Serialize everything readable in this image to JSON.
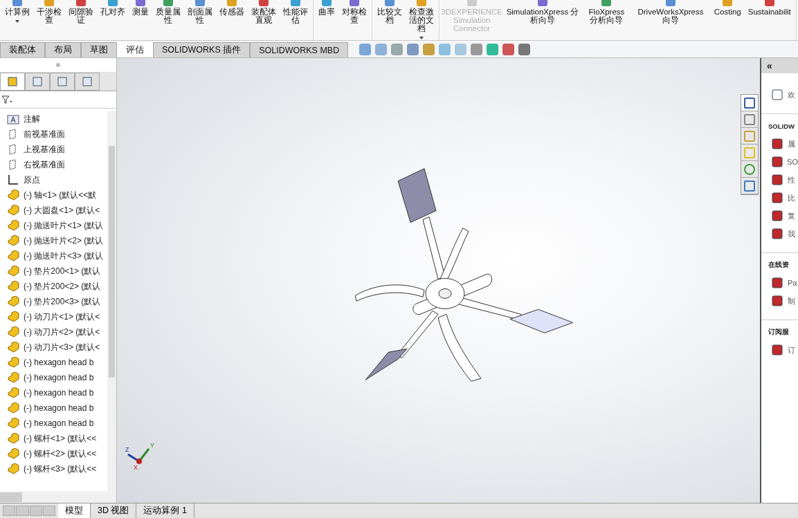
{
  "ribbon": {
    "groups": [
      {
        "buttons": [
          {
            "label": "计算例",
            "dropdown": true,
            "disabled": false
          },
          {
            "label": "干涉检查",
            "dropdown": false,
            "disabled": false
          },
          {
            "label": "间隙验证",
            "dropdown": false,
            "disabled": false
          },
          {
            "label": "孔对齐",
            "dropdown": false,
            "disabled": false
          },
          {
            "label": "测量",
            "dropdown": false,
            "disabled": false
          },
          {
            "label": "质量属性",
            "dropdown": false,
            "disabled": false
          },
          {
            "label": "剖面属性",
            "dropdown": false,
            "disabled": false
          },
          {
            "label": "传感器",
            "dropdown": false,
            "disabled": false
          },
          {
            "label": "装配体直观",
            "dropdown": false,
            "disabled": false
          },
          {
            "label": "性能评估",
            "dropdown": false,
            "disabled": false
          }
        ]
      },
      {
        "buttons": [
          {
            "label": "曲率",
            "dropdown": false,
            "disabled": false
          },
          {
            "label": "对称检查",
            "dropdown": false,
            "disabled": false
          }
        ]
      },
      {
        "buttons": [
          {
            "label": "比较文档",
            "dropdown": false,
            "disabled": false
          },
          {
            "label": "检查激活的文档",
            "dropdown": true,
            "disabled": false
          }
        ]
      },
      {
        "buttons": [
          {
            "label": "3DEXPERIENCE Simulation Connector",
            "dropdown": false,
            "disabled": true
          },
          {
            "label": "SimulationXpress 分析向导",
            "dropdown": false,
            "disabled": false
          },
          {
            "label": "FloXpress 分析向导",
            "dropdown": false,
            "disabled": false
          },
          {
            "label": "DriveWorksXpress 向导",
            "dropdown": false,
            "disabled": false
          },
          {
            "label": "Costing",
            "dropdown": false,
            "disabled": false
          },
          {
            "label": "Sustainabilit",
            "dropdown": false,
            "disabled": false
          }
        ]
      }
    ]
  },
  "tabs": [
    {
      "label": "装配体",
      "selected": false
    },
    {
      "label": "布局",
      "selected": false
    },
    {
      "label": "草图",
      "selected": false
    },
    {
      "label": "评估",
      "selected": true
    },
    {
      "label": "SOLIDWORKS 插件",
      "selected": false
    },
    {
      "label": "SOLIDWORKS MBD",
      "selected": false
    }
  ],
  "panel_tabs": [
    {
      "selected": true
    },
    {
      "selected": false
    },
    {
      "selected": false
    },
    {
      "selected": false
    }
  ],
  "task_pane_tabs": [
    {
      "selected": true
    },
    {
      "selected": false
    },
    {
      "selected": false
    },
    {
      "selected": false
    },
    {
      "selected": false
    },
    {
      "selected": false
    }
  ],
  "feature_tree": {
    "items": [
      {
        "kind": "annotation",
        "label": "注解"
      },
      {
        "kind": "plane",
        "label": "前视基准面"
      },
      {
        "kind": "plane",
        "label": "上视基准面"
      },
      {
        "kind": "plane",
        "label": "右视基准面"
      },
      {
        "kind": "origin",
        "label": "原点"
      },
      {
        "kind": "part",
        "label": "(-) 轴<1> (默认<<默"
      },
      {
        "kind": "part",
        "label": "(-) 大圆盘<1> (默认<"
      },
      {
        "kind": "part",
        "label": "(-) 抛送叶片<1> (默认"
      },
      {
        "kind": "part",
        "label": "(-) 抛送叶片<2> (默认"
      },
      {
        "kind": "part",
        "label": "(-) 抛送叶片<3> (默认"
      },
      {
        "kind": "part",
        "label": "(-) 垫片200<1> (默认"
      },
      {
        "kind": "part",
        "label": "(-) 垫片200<2> (默认"
      },
      {
        "kind": "part",
        "label": "(-) 垫片200<3> (默认"
      },
      {
        "kind": "part",
        "label": "(-) 动刀片<1> (默认<"
      },
      {
        "kind": "part",
        "label": "(-) 动刀片<2> (默认<"
      },
      {
        "kind": "part",
        "label": "(-) 动刀片<3> (默认<"
      },
      {
        "kind": "part",
        "label": "(-) hexagon head b"
      },
      {
        "kind": "part",
        "label": "(-) hexagon head b"
      },
      {
        "kind": "part",
        "label": "(-) hexagon head b"
      },
      {
        "kind": "part",
        "label": "(-) hexagon head b"
      },
      {
        "kind": "part",
        "label": "(-) hexagon head b"
      },
      {
        "kind": "part",
        "label": "(-) 螺杆<1> (默认<<"
      },
      {
        "kind": "part",
        "label": "(-) 螺杆<2> (默认<<"
      },
      {
        "kind": "part",
        "label": "(-) 螺杆<3> (默认<<"
      }
    ]
  },
  "triad": {
    "x": "X",
    "y": "Y",
    "z": "Z"
  },
  "bottom_tabs": [
    {
      "label": "模型",
      "selected": true
    },
    {
      "label": "3D 视图",
      "selected": false
    },
    {
      "label": "运动算例 1",
      "selected": false
    }
  ],
  "task_pane": {
    "collapse": "«",
    "items": [
      {
        "kind": "home",
        "label": "欢"
      },
      {
        "kind": "heading",
        "label": "SOLIDW"
      },
      {
        "kind": "link",
        "label": "属"
      },
      {
        "kind": "link",
        "label": "SO"
      },
      {
        "kind": "link",
        "label": "性"
      },
      {
        "kind": "link",
        "label": "比"
      },
      {
        "kind": "link",
        "label": "复"
      },
      {
        "kind": "link",
        "label": "我"
      },
      {
        "kind": "heading",
        "label": "在线资"
      },
      {
        "kind": "link",
        "label": "Pa"
      },
      {
        "kind": "link",
        "label": "制"
      },
      {
        "kind": "heading",
        "label": "订阅服"
      },
      {
        "kind": "link",
        "label": "订"
      }
    ]
  }
}
